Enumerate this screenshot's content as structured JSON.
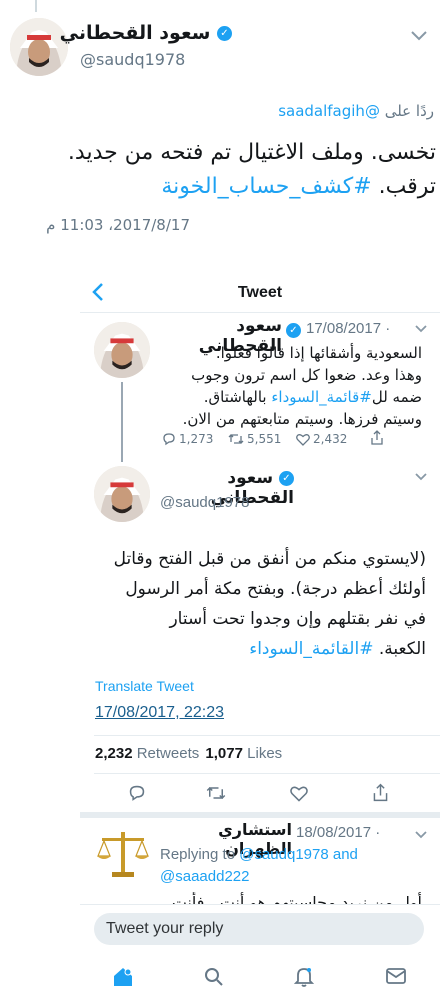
{
  "outer": {
    "author_name": "سعود القحطاني",
    "author_handle": "@saudq1978",
    "replying_prefix": "ردًا على",
    "replying_handle": "@saadalfagih",
    "body_line1": "تخسى.  وملف الاغتيال تم فتحه من جديد.",
    "body_line2_text": "ترقب.",
    "body_line2_hashtag": "#كشف_حساب_الخونة",
    "timestamp": "2017/8/17، 11:03 م"
  },
  "embedded": {
    "header_title": "Tweet",
    "tweet1": {
      "author_name": "سعود القحطاني",
      "date": "17/08/2017 ·",
      "lines": [
        "السعودية وأشقائها إذا قالوا فعلوا.",
        "وهذا وعد. ضعوا كل اسم ترون وجوب",
        "ضمه لل",
        "#قائمة_السوداء",
        "بالهاشتاق.",
        "وسيتم فرزها. وسيتم متابعتهم من الان."
      ],
      "replies": "1,273",
      "retweets": "5,551",
      "likes": "2,432"
    },
    "tweet2": {
      "author_name": "سعود القحطاني",
      "author_handle": "@saudq1978",
      "lines": [
        "(لايستوي منكم من أنفق من قبل الفتح وقاتل",
        "أولئك أعظم درجة). وبفتح مكة أمر الرسول",
        "في نفر بقتلهم وإن وجدوا تحت أستار",
        "الكعبة."
      ],
      "hashtag": "#القائمة_السوداء",
      "translate": "Translate Tweet",
      "timestamp": "17/08/2017, 22:23",
      "retweets_count": "2,232",
      "retweets_label": "Retweets",
      "likes_count": "1,077",
      "likes_label": "Likes"
    },
    "reply": {
      "author_name": "استشاري الظهران",
      "date": "18/08/2017 ·",
      "replying_to": "Replying to",
      "handle1": "@saudq1978 and",
      "handle2": "@saaadd222",
      "partial_text": "أول من نريد محاسبتهم هو أنت ، فأنت"
    },
    "reply_placeholder": "Tweet your reply"
  },
  "colors": {
    "link": "#1da1f2",
    "muted": "#657786",
    "divider": "#e6ecf0"
  }
}
